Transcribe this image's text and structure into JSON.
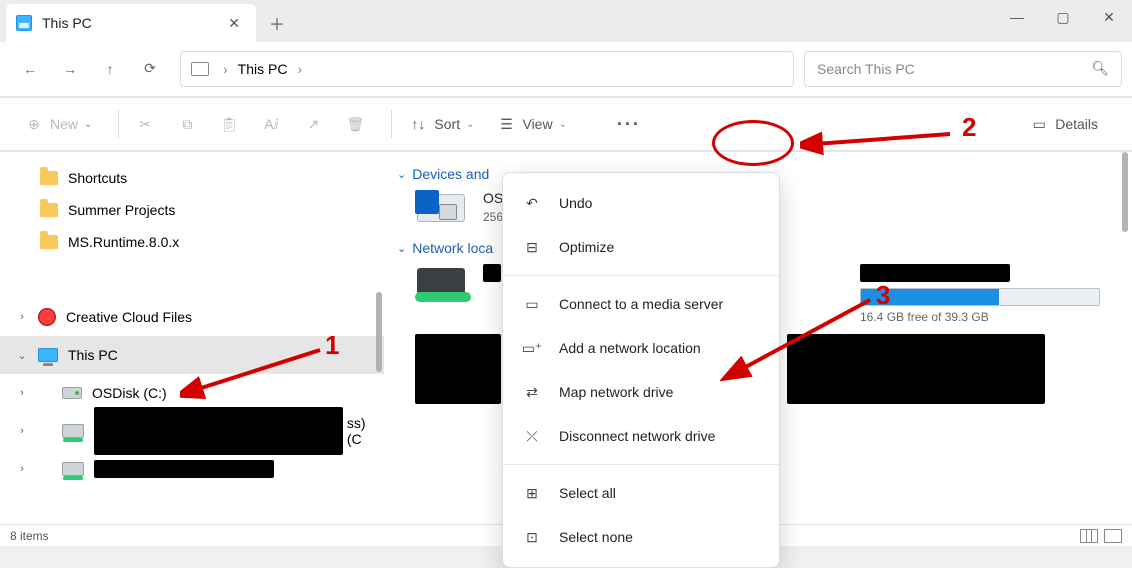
{
  "tab": {
    "title": "This PC"
  },
  "breadcrumb": {
    "location": "This PC"
  },
  "search": {
    "placeholder": "Search This PC"
  },
  "toolbar": {
    "new": "New",
    "sort": "Sort",
    "view": "View",
    "details": "Details"
  },
  "sidebar": {
    "quick": [
      {
        "label": "Shortcuts"
      },
      {
        "label": "Summer Projects"
      },
      {
        "label": "MS.Runtime.8.0.x"
      }
    ],
    "cc": "Creative Cloud Files",
    "thispc": "This PC",
    "drives": [
      {
        "label": "OSDisk (C:)"
      },
      {
        "label": "ss) (C"
      }
    ]
  },
  "content": {
    "group_devices": "Devices and",
    "group_network": "Network loca",
    "device_partial_name": "OS",
    "device_partial_sub": "256",
    "netdrive": {
      "free_text": "16.4 GB free of 39.3 GB",
      "fill_pct": 58
    }
  },
  "menu": {
    "undo": "Undo",
    "optimize": "Optimize",
    "media": "Connect to a media server",
    "addloc": "Add a network location",
    "mapdrv": "Map network drive",
    "disconnect": "Disconnect network drive",
    "selall": "Select all",
    "selnone": "Select none"
  },
  "status": {
    "count": "8 items"
  },
  "annotations": {
    "n1": "1",
    "n2": "2",
    "n3": "3"
  }
}
